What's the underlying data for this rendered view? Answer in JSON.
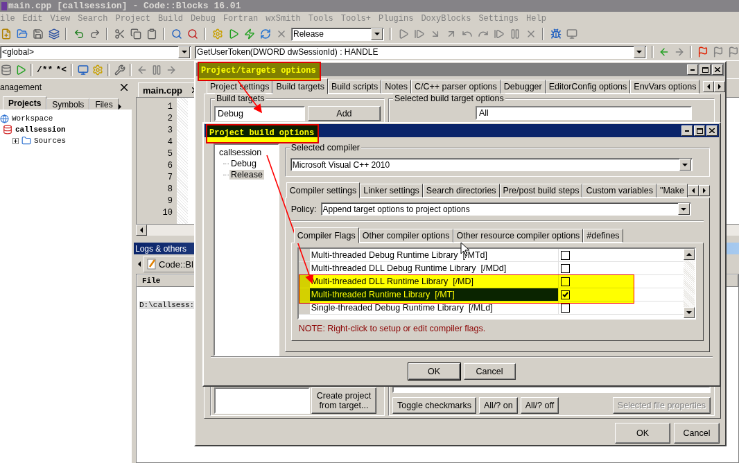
{
  "window": {
    "title": "main.cpp [callsession] - Code::Blocks 16.01"
  },
  "menu": [
    "ile",
    "Edit",
    "View",
    "Search",
    "Project",
    "Build",
    "Debug",
    "Fortran",
    "wxSmith",
    "Tools",
    "Tools+",
    "Plugins",
    "DoxyBlocks",
    "Settings",
    "Help"
  ],
  "toolbar": {
    "build_target": "Release",
    "scope": "<global>",
    "function": "GetUserToken(DWORD dwSessionId) : HANDLE",
    "comment_buttons": [
      "/**",
      "*<"
    ]
  },
  "management": {
    "title": "anagement",
    "tabs": [
      {
        "label": "Projects",
        "selected": true
      },
      {
        "label": "Symbols",
        "selected": false
      },
      {
        "label": "Files",
        "selected": false
      }
    ],
    "tree": [
      {
        "label": "Workspace",
        "bold": false,
        "children": [
          {
            "label": "callsession",
            "bold": true,
            "children": [
              {
                "label": "Sources",
                "bold": false,
                "expanded": false
              }
            ]
          }
        ]
      }
    ]
  },
  "editor": {
    "tab": "main.cpp",
    "line_numbers": [
      "1",
      "2",
      "3",
      "4",
      "5",
      "6",
      "7",
      "8",
      "9",
      "10"
    ]
  },
  "logs": {
    "title": "Logs & others",
    "tab": "Code::Bl",
    "column": "File",
    "row": "D:\\callsess:"
  },
  "targets_dialog": {
    "title": "Project/targets options",
    "title_highlighted": true,
    "tabs": [
      {
        "label": "Project settings",
        "selected": false
      },
      {
        "label": "Build targets",
        "selected": true
      },
      {
        "label": "Build scripts",
        "selected": false
      },
      {
        "label": "Notes",
        "selected": false
      },
      {
        "label": "C/C++ parser options",
        "selected": false
      },
      {
        "label": "Debugger",
        "selected": false
      },
      {
        "label": "EditorConfig options",
        "selected": false
      },
      {
        "label": "EnvVars options",
        "selected": false
      }
    ],
    "targets_group": "Build targets",
    "target_item": "Debug",
    "add_button": "Add",
    "options_group": "Selected build target options",
    "platform": "All",
    "create_button": "Create project from target...",
    "file_buttons": [
      {
        "label": "Toggle checkmarks",
        "disabled": false
      },
      {
        "label": "All/? on",
        "disabled": false
      },
      {
        "label": "All/? off",
        "disabled": false
      },
      {
        "label": "Selected file properties",
        "disabled": true
      }
    ],
    "buttons": [
      "OK",
      "Cancel"
    ]
  },
  "build_options_dialog": {
    "title": "Project build options",
    "title_highlighted": true,
    "tree": {
      "label": "callsession",
      "selected": false,
      "children": [
        {
          "label": "Debug",
          "selected": false
        },
        {
          "label": "Release",
          "selected": true
        }
      ]
    },
    "compiler_group": "Selected compiler",
    "compiler": "Microsoft Visual C++ 2010",
    "tabs": [
      {
        "label": "Compiler settings",
        "selected": true
      },
      {
        "label": "Linker settings",
        "selected": false
      },
      {
        "label": "Search directories",
        "selected": false
      },
      {
        "label": "Pre/post build steps",
        "selected": false
      },
      {
        "label": "Custom variables",
        "selected": false
      },
      {
        "label": "\"Make",
        "selected": false
      }
    ],
    "policy_label": "Policy:",
    "policy": "Append target options to project options",
    "subtabs": [
      {
        "label": "Compiler Flags",
        "selected": true
      },
      {
        "label": "Other compiler options",
        "selected": false
      },
      {
        "label": "Other resource compiler options",
        "selected": false
      },
      {
        "label": "#defines",
        "selected": false
      }
    ],
    "flags": [
      {
        "label": "Multi-threaded Debug Runtime Library  [/MTd]",
        "checked": false,
        "selected": false,
        "highlighted": false
      },
      {
        "label": "Multi-threaded DLL Debug Runtime Library  [/MDd]",
        "checked": false,
        "selected": false,
        "highlighted": false
      },
      {
        "label": "Multi-threaded DLL Runtime Library  [/MD]",
        "checked": false,
        "selected": false,
        "highlighted": true
      },
      {
        "label": "Multi-threaded Runtime Library  [/MT]",
        "checked": true,
        "selected": true,
        "highlighted": true
      },
      {
        "label": "Single-threaded Debug Runtime Library  [/MLd]",
        "checked": false,
        "selected": false,
        "highlighted": false
      }
    ],
    "note": "NOTE: Right-click to setup or edit compiler flags.",
    "buttons": [
      "OK",
      "Cancel"
    ]
  }
}
